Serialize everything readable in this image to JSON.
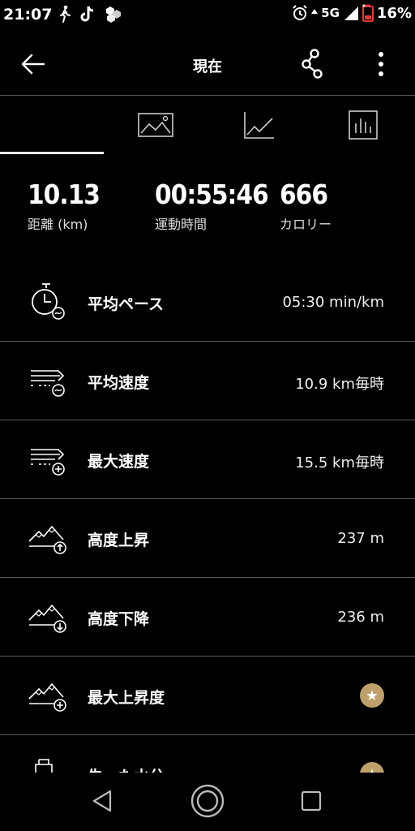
{
  "status_bar": {
    "time": "21:07",
    "network": "5G",
    "battery": "16%"
  },
  "app_bar": {
    "title": "現在"
  },
  "tabs": [
    "overview",
    "photo",
    "graph",
    "laps"
  ],
  "summary": {
    "distance": {
      "value": "10.13",
      "label": "距離 (km)"
    },
    "duration": {
      "value": "00:55:46",
      "label": "運動時間"
    },
    "calories": {
      "value": "666",
      "label": "カロリー"
    }
  },
  "metrics": [
    {
      "icon": "stopwatch-icon",
      "label": "平均ペース",
      "value": "05:30 min/km"
    },
    {
      "icon": "speed-average-icon",
      "label": "平均速度",
      "value": "10.9 km毎時"
    },
    {
      "icon": "speed-max-icon",
      "label": "最大速度",
      "value": "15.5 km毎時"
    },
    {
      "icon": "mountain-up-icon",
      "label": "高度上昇",
      "value": "237 m"
    },
    {
      "icon": "mountain-down-icon",
      "label": "高度下降",
      "value": "236 m"
    },
    {
      "icon": "mountain-max-icon",
      "label": "最大上昇度",
      "premium": true
    },
    {
      "icon": "water-bottle-icon",
      "label": "失った水分",
      "premium": true
    }
  ],
  "colors": {
    "background": "#000000",
    "divider": "#5a5a5a",
    "premium_badge": "#bfa06a"
  }
}
